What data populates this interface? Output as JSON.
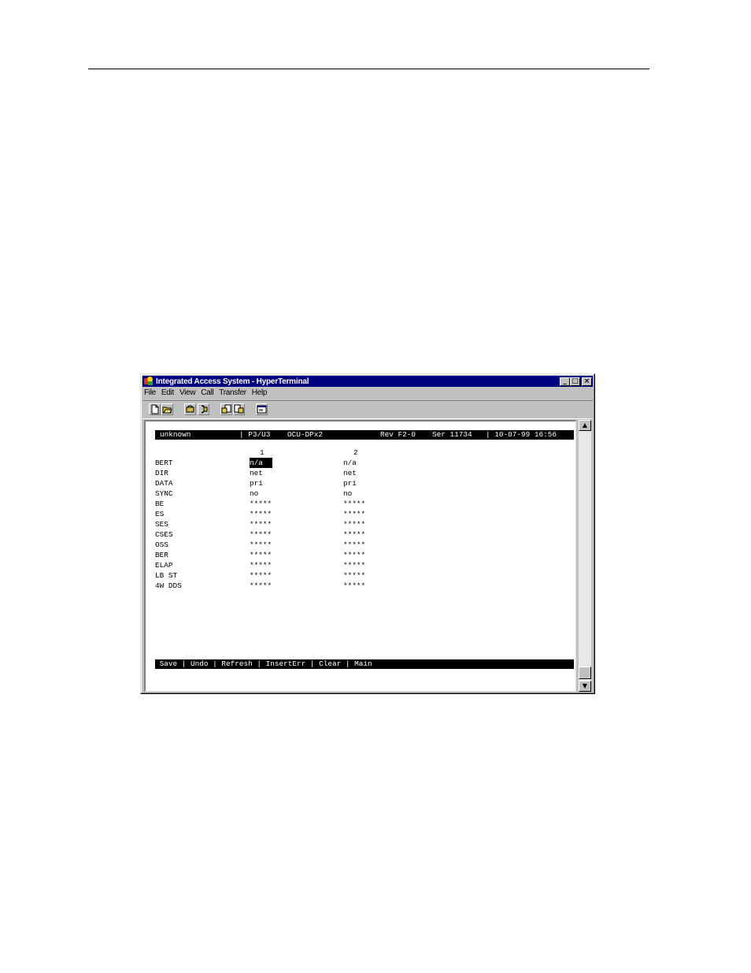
{
  "window": {
    "title": "Integrated Access System - HyperTerminal",
    "controls": {
      "minimize": "_",
      "maximize": "□",
      "close": "×"
    }
  },
  "menu": [
    "File",
    "Edit",
    "View",
    "Call",
    "Transfer",
    "Help"
  ],
  "toolbar_icons": [
    "new-icon",
    "open-icon",
    "connect-icon",
    "disconnect-icon",
    "send-icon",
    "receive-icon",
    "properties-icon"
  ],
  "terminal": {
    "header": {
      "name": "unknown",
      "slot": "| P3/U3",
      "card": "OCU-DPx2",
      "rev": "Rev F2-0",
      "ser": "Ser 11734",
      "datetime": "| 10-07-99 16:56"
    },
    "columns": [
      "1",
      "2"
    ],
    "rows": [
      {
        "label": "BERT",
        "c1": "n/a",
        "c2": "n/a"
      },
      {
        "label": "DIR",
        "c1": "net",
        "c2": "net"
      },
      {
        "label": "DATA",
        "c1": "pri",
        "c2": "pri"
      },
      {
        "label": "SYNC",
        "c1": "no",
        "c2": "no"
      },
      {
        "label": "BE",
        "c1": "*****",
        "c2": "*****"
      },
      {
        "label": "ES",
        "c1": "*****",
        "c2": "*****"
      },
      {
        "label": "SES",
        "c1": "*****",
        "c2": "*****"
      },
      {
        "label": "CSES",
        "c1": "*****",
        "c2": "*****"
      },
      {
        "label": "OSS",
        "c1": "*****",
        "c2": "*****"
      },
      {
        "label": "BER",
        "c1": "*****",
        "c2": "*****"
      },
      {
        "label": "ELAP",
        "c1": "*****",
        "c2": "*****"
      },
      {
        "label": "LB ST",
        "c1": "*****",
        "c2": "*****"
      },
      {
        "label": "4W DDS",
        "c1": "*****",
        "c2": "*****"
      }
    ],
    "footer": " Save | Undo | Refresh | InsertErr | Clear | Main"
  },
  "scrollbar": {
    "up": "▲",
    "down": "▼"
  }
}
